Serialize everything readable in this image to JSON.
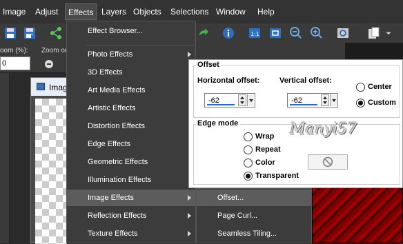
{
  "menubar": {
    "items": [
      {
        "label": "Image"
      },
      {
        "label": "Adjust"
      },
      {
        "label": "Effects"
      },
      {
        "label": "Layers"
      },
      {
        "label": "Objects"
      },
      {
        "label": "Selections"
      },
      {
        "label": "Window"
      },
      {
        "label": "Help"
      }
    ]
  },
  "options": {
    "zoom_label": "oom (%):",
    "zoom_out_label": "Zoom out",
    "zoom_value": "0"
  },
  "document": {
    "title": "Imag"
  },
  "effects_menu": {
    "items": [
      {
        "label": "Effect Browser...",
        "submenu": false
      },
      {
        "label": "Photo Effects",
        "submenu": true
      },
      {
        "label": "3D Effects",
        "submenu": true
      },
      {
        "label": "Art Media Effects",
        "submenu": true
      },
      {
        "label": "Artistic Effects",
        "submenu": true
      },
      {
        "label": "Distortion Effects",
        "submenu": true
      },
      {
        "label": "Edge Effects",
        "submenu": true
      },
      {
        "label": "Geometric Effects",
        "submenu": true
      },
      {
        "label": "Illumination Effects",
        "submenu": true
      },
      {
        "label": "Image Effects",
        "submenu": true
      },
      {
        "label": "Reflection Effects",
        "submenu": true
      },
      {
        "label": "Texture Effects",
        "submenu": true
      }
    ]
  },
  "image_effects_submenu": {
    "items": [
      {
        "label": "Offset..."
      },
      {
        "label": "Page Curl..."
      },
      {
        "label": "Seamless Tiling..."
      }
    ]
  },
  "offset_dialog": {
    "group_title": "Offset",
    "horizontal_label": "Horizontal offset:",
    "horizontal_value": "-62",
    "vertical_label": "Vertical offset:",
    "vertical_value": "-62",
    "center_label": "Center",
    "custom_label": "Custom",
    "center_selected": false,
    "custom_selected": true,
    "edge_mode_title": "Edge mode",
    "edge_modes": [
      {
        "label": "Wrap",
        "selected": false
      },
      {
        "label": "Repeat",
        "selected": false
      },
      {
        "label": "Color",
        "selected": false
      },
      {
        "label": "Transparent",
        "selected": true
      }
    ]
  },
  "watermark": "Manyi57",
  "colors": {
    "menu_bg": "#3c3c3c",
    "menu_highlight": "#5c5c5c",
    "accent": "#2a6ad0"
  }
}
